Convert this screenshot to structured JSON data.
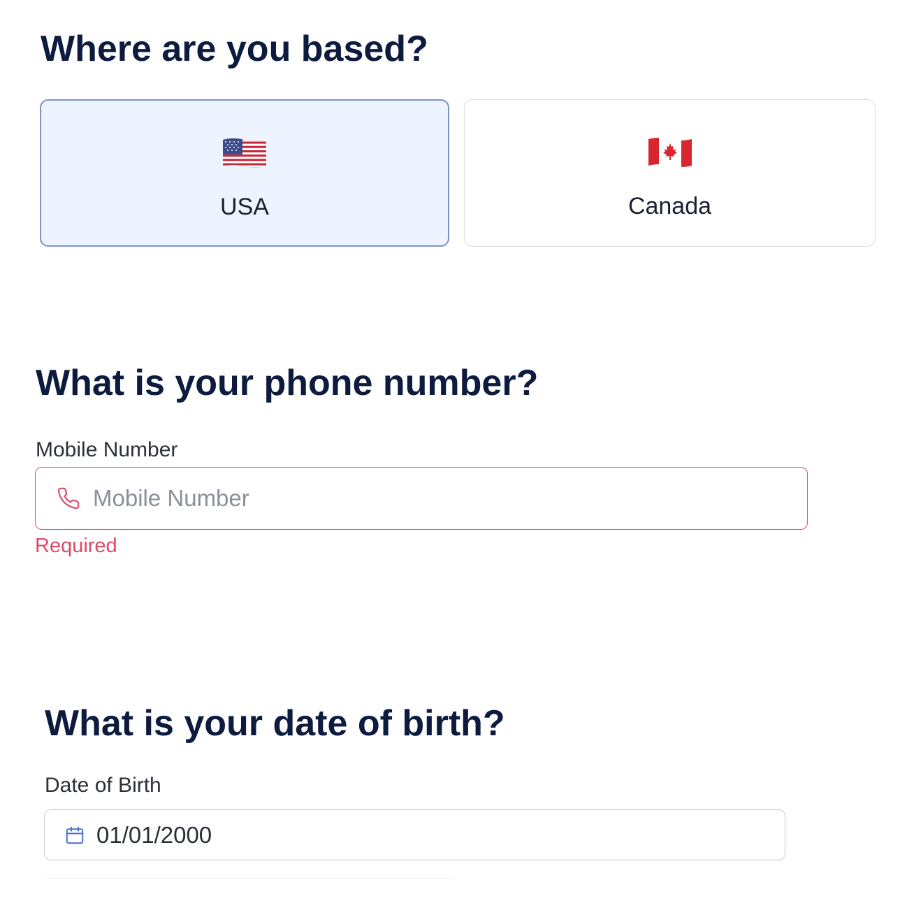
{
  "country_section": {
    "heading": "Where are you based?",
    "options": [
      {
        "label": "USA",
        "flag": "us-flag-icon",
        "selected": true
      },
      {
        "label": "Canada",
        "flag": "canada-flag-icon",
        "selected": false
      }
    ],
    "selected_border_color": "#7c93c4",
    "selected_background": "#eef4ff"
  },
  "phone_section": {
    "heading": "What is your phone number?",
    "field_label": "Mobile Number",
    "placeholder": "Mobile Number",
    "value": "",
    "icon": "phone-icon",
    "error_text": "Required",
    "error_color": "#dc4a68"
  },
  "dob_section": {
    "heading": "What is your date of birth?",
    "field_label": "Date of Birth",
    "value": "01/01/2000",
    "icon": "calendar-icon"
  }
}
